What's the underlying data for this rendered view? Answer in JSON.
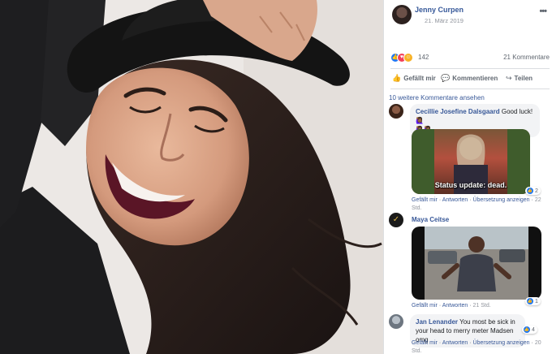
{
  "post": {
    "author": "Jenny Curpen",
    "date": "21. März 2019",
    "reaction_count": "142",
    "comment_count": "21 Kommentare"
  },
  "actions": {
    "like": "Gefällt mir",
    "comment": "Kommentieren",
    "share": "Teilen"
  },
  "comments_header": "10 weitere Kommentare ansehen",
  "comments": [
    {
      "name": "Cecillie Josefine Dalsgaard",
      "text": "Good luck! 🙋🏾‍♀️",
      "text2": "🙋🏾‍♀️🙋🏾‍♀️",
      "gif_caption": "Status update: dead.",
      "like": "Gefällt mir",
      "reply": "Antworten",
      "translate": "Übersetzung anzeigen",
      "time": "22 Std.",
      "likes": "2"
    },
    {
      "name": "Maya Ceitse",
      "like": "Gefällt mir",
      "reply": "Antworten",
      "time": "21 Std.",
      "likes": "1"
    },
    {
      "name": "Jan Lenander",
      "text": "You most be sick in your head to merry meter Madsen omg",
      "like": "Gefällt mir",
      "reply": "Antworten",
      "translate": "Übersetzung anzeigen",
      "time": "20 Std.",
      "likes": "4"
    }
  ],
  "colors": {
    "link": "#385898",
    "bubble": "#f2f3f5",
    "like_blue": "#2078f4"
  }
}
